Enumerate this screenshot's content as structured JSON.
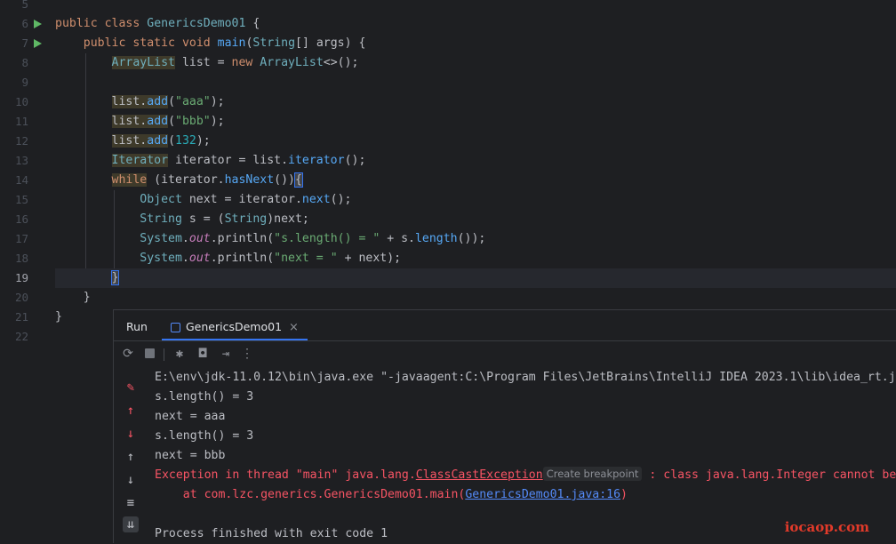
{
  "editor": {
    "line_numbers": [
      "5",
      "6",
      "7",
      "8",
      "9",
      "10",
      "11",
      "12",
      "13",
      "14",
      "15",
      "16",
      "17",
      "18",
      "19",
      "20",
      "21",
      "22"
    ],
    "current_line": "19",
    "code": {
      "l6_kw1": "public",
      "l6_kw2": "class",
      "l6_name": "GenericsDemo01",
      "l6_brace": "{",
      "l7_kw1": "public",
      "l7_kw2": "static",
      "l7_kw3": "void",
      "l7_fn": "main",
      "l7_rest1": "(",
      "l7_type": "String",
      "l7_rest2": "[] args) {",
      "l8_type": "ArrayList",
      "l8_mid": " list = ",
      "l8_kw": "new",
      "l8_type2": " ArrayList",
      "l8_end": "<>();",
      "l10_obj": "list",
      "l10_dot": ".",
      "l10_m": "add",
      "l10_open": "(",
      "l10_str": "\"aaa\"",
      "l10_end": ");",
      "l11_obj": "list",
      "l11_dot": ".",
      "l11_m": "add",
      "l11_open": "(",
      "l11_str": "\"bbb\"",
      "l11_end": ");",
      "l12_obj": "list",
      "l12_dot": ".",
      "l12_m": "add",
      "l12_open": "(",
      "l12_num": "132",
      "l12_end": ");",
      "l13_type": "Iterator",
      "l13_mid": " iterator = list.",
      "l13_m": "iterator",
      "l13_end": "();",
      "l14_kw": "while",
      "l14_mid": " (iterator.",
      "l14_m": "hasNext",
      "l14_end": "())",
      "l14_brace": "{",
      "l15_type": "Object",
      "l15_mid": " next = iterator.",
      "l15_m": "next",
      "l15_end": "();",
      "l16_type": "String",
      "l16_mid": " s = (",
      "l16_type2": "String",
      "l16_end": ")next;",
      "l17_type": "System",
      "l17_dot": ".",
      "l17_fld": "out",
      "l17_m": ".println(",
      "l17_str": "\"s.length() = \"",
      "l17_mid": " + s.",
      "l17_m2": "length",
      "l17_end": "());",
      "l18_type": "System",
      "l18_dot": ".",
      "l18_fld": "out",
      "l18_m": ".println(",
      "l18_str": "\"next = \"",
      "l18_end": " + next);",
      "l19_brace": "}",
      "l20_brace": "}",
      "l21_brace": "}"
    }
  },
  "run_panel": {
    "tab_run": "Run",
    "tab_file": "GenericsDemo01",
    "console": {
      "cmd": "E:\\env\\jdk-11.0.12\\bin\\java.exe \"-javaagent:C:\\Program Files\\JetBrains\\IntelliJ IDEA 2023.1\\lib\\idea_rt.j",
      "out1": "s.length() = 3",
      "out2": "next = aaa",
      "out3": "s.length() = 3",
      "out4": "next = bbb",
      "exc_prefix": "Exception in thread \"main\" java.lang.",
      "exc_class": "ClassCastException",
      "breakpoint": "Create breakpoint",
      "exc_suffix": " : class java.lang.Integer cannot be",
      "at_prefix": "    at com.lzc.generics.GenericsDemo01.main(",
      "at_link": "GenericsDemo01.java:16",
      "at_suffix": ")",
      "finish": "Process finished with exit code 1"
    }
  },
  "watermark": "iocaop.com",
  "colors": {
    "accent": "#3574f0",
    "run_green": "#5fb865",
    "error_red": "#f75464"
  }
}
